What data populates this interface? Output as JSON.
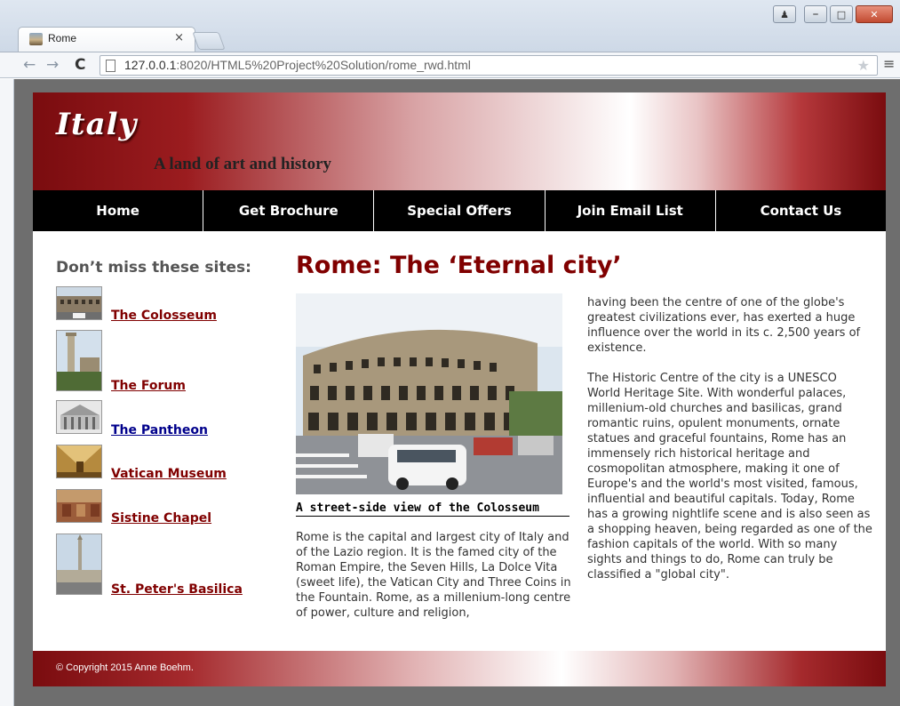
{
  "browser": {
    "tab_title": "Rome",
    "tab_close": "×",
    "url_host": "127.0.0.1",
    "url_path": ":8020/HTML5%20Project%20Solution/rome_rwd.html",
    "icons": [
      "back-icon",
      "forward-icon",
      "reload-icon",
      "page-icon",
      "star-icon",
      "menu-icon"
    ],
    "window_buttons": [
      "user-icon",
      "minimize-icon",
      "maximize-icon",
      "close-icon"
    ]
  },
  "header": {
    "logo": "Italy",
    "tagline": "A land of art and history"
  },
  "nav": [
    {
      "label": "Home"
    },
    {
      "label": "Get Brochure"
    },
    {
      "label": "Special Offers"
    },
    {
      "label": "Join Email List"
    },
    {
      "label": "Contact Us"
    }
  ],
  "sidebar": {
    "heading": "Don’t miss these sites:",
    "sites": [
      {
        "label": "The Colosseum"
      },
      {
        "label": "The Forum"
      },
      {
        "label": "The Pantheon"
      },
      {
        "label": "Vatican Museum"
      },
      {
        "label": "Sistine Chapel"
      },
      {
        "label": "St. Peter's Basilica"
      }
    ]
  },
  "main": {
    "heading": "Rome: The ‘Eternal city’",
    "caption": "A street-side view of the Colosseum",
    "para1": "Rome is the capital and largest city of Italy and of the Lazio region. It is the famed city of the Roman Empire, the Seven Hills, La Dolce Vita (sweet life), the Vatican City and Three Coins in the Fountain. Rome, as a millenium-long centre of power, culture and religion,",
    "para2": "having been the centre of one of the globe's greatest civilizations ever, has exerted a huge influence over the world in its c. 2,500 years of existence.",
    "para3": "The Historic Centre of the city is a UNESCO World Heritage Site. With wonderful palaces, millenium-old churches and basilicas, grand romantic ruins, opulent monuments, ornate statues and graceful fountains, Rome has an immensely rich historical heritage and cosmopolitan atmosphere, making it one of Europe's and the world's most visited, famous, influential and beautiful capitals. Today, Rome has a growing nightlife scene and is also seen as a shopping heaven, being regarded as one of the fashion capitals of the world. With so many sights and things to do, Rome can truly be classified a \"global city\"."
  },
  "footer": {
    "copyright": "© Copyright 2015 Anne Boehm."
  },
  "colors": {
    "brand_red": "#800000",
    "nav_bg": "#000000",
    "visited_link": "#00008b"
  }
}
